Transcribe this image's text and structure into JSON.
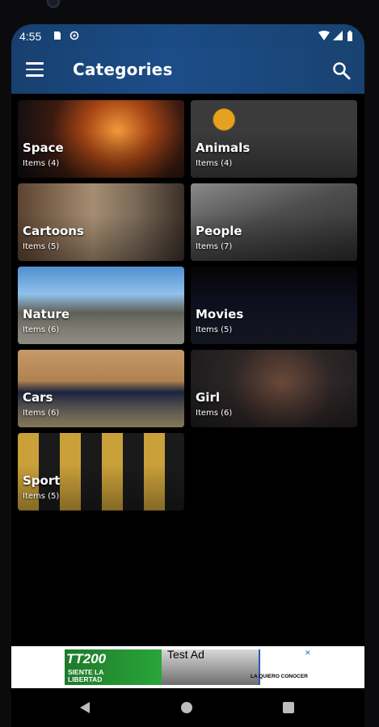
{
  "status_bar": {
    "time": "4:55"
  },
  "app_bar": {
    "title": "Categories"
  },
  "categories": [
    {
      "name": "Space",
      "count": "Items (4)"
    },
    {
      "name": "Animals",
      "count": "Items (4)"
    },
    {
      "name": "Cartoons",
      "count": "Items (5)"
    },
    {
      "name": "People",
      "count": "Items (7)"
    },
    {
      "name": "Nature",
      "count": "Items (6)"
    },
    {
      "name": "Movies",
      "count": "Items (5)"
    },
    {
      "name": "Cars",
      "count": "Items (6)"
    },
    {
      "name": "Girl",
      "count": "Items (6)"
    },
    {
      "name": "Sport",
      "count": "Items (5)"
    }
  ],
  "ad": {
    "label": "Test Ad",
    "brand": "TT200",
    "tagline": "SIENTE LA LIBERTAD",
    "right_text": "LA QUIERO CONOCER"
  },
  "icons": {
    "menu": "menu-icon",
    "search": "search-icon",
    "back": "back-icon",
    "home": "home-icon",
    "recents": "recents-icon"
  },
  "colors": {
    "app_bar": "#1b4b85",
    "background": "#000000"
  }
}
